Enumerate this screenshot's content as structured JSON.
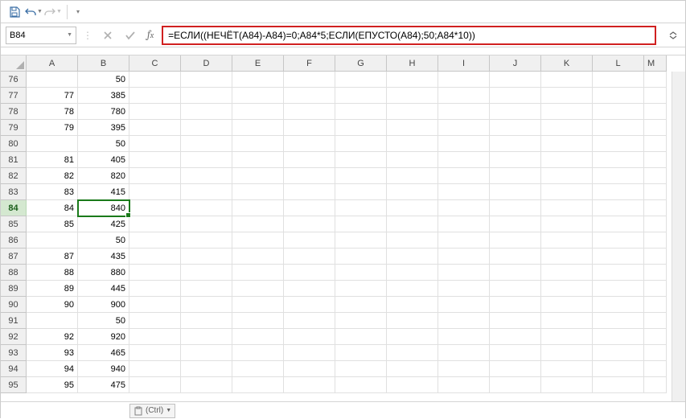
{
  "name_box": "B84",
  "formula": "=ЕСЛИ((НЕЧЁТ(A84)-A84)=0;A84*5;ЕСЛИ(ЕПУСТО(A84);50;A84*10))",
  "columns": [
    "A",
    "B",
    "C",
    "D",
    "E",
    "F",
    "G",
    "H",
    "I",
    "J",
    "K",
    "L",
    "M"
  ],
  "active_cell": {
    "row": 84,
    "col": "B"
  },
  "rows": [
    {
      "r": 76,
      "a": "",
      "b": 50
    },
    {
      "r": 77,
      "a": 77,
      "b": 385
    },
    {
      "r": 78,
      "a": 78,
      "b": 780
    },
    {
      "r": 79,
      "a": 79,
      "b": 395
    },
    {
      "r": 80,
      "a": "",
      "b": 50
    },
    {
      "r": 81,
      "a": 81,
      "b": 405
    },
    {
      "r": 82,
      "a": 82,
      "b": 820
    },
    {
      "r": 83,
      "a": 83,
      "b": 415
    },
    {
      "r": 84,
      "a": 84,
      "b": 840
    },
    {
      "r": 85,
      "a": 85,
      "b": 425
    },
    {
      "r": 86,
      "a": "",
      "b": 50
    },
    {
      "r": 87,
      "a": 87,
      "b": 435
    },
    {
      "r": 88,
      "a": 88,
      "b": 880
    },
    {
      "r": 89,
      "a": 89,
      "b": 445
    },
    {
      "r": 90,
      "a": 90,
      "b": 900
    },
    {
      "r": 91,
      "a": "",
      "b": 50
    },
    {
      "r": 92,
      "a": 92,
      "b": 920
    },
    {
      "r": 93,
      "a": 93,
      "b": 465
    },
    {
      "r": 94,
      "a": 94,
      "b": 940
    },
    {
      "r": 95,
      "a": 95,
      "b": 475
    }
  ],
  "paste_tag": "(Ctrl)"
}
